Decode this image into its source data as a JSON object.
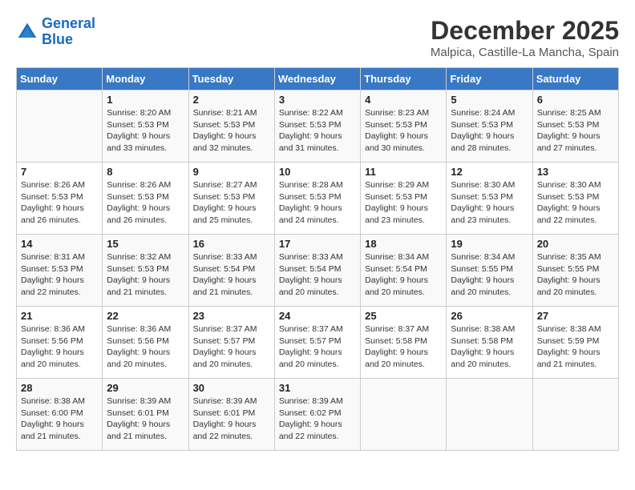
{
  "logo": {
    "line1": "General",
    "line2": "Blue"
  },
  "title": "December 2025",
  "location": "Malpica, Castille-La Mancha, Spain",
  "headers": [
    "Sunday",
    "Monday",
    "Tuesday",
    "Wednesday",
    "Thursday",
    "Friday",
    "Saturday"
  ],
  "weeks": [
    [
      {
        "day": "",
        "info": ""
      },
      {
        "day": "1",
        "info": "Sunrise: 8:20 AM\nSunset: 5:53 PM\nDaylight: 9 hours\nand 33 minutes."
      },
      {
        "day": "2",
        "info": "Sunrise: 8:21 AM\nSunset: 5:53 PM\nDaylight: 9 hours\nand 32 minutes."
      },
      {
        "day": "3",
        "info": "Sunrise: 8:22 AM\nSunset: 5:53 PM\nDaylight: 9 hours\nand 31 minutes."
      },
      {
        "day": "4",
        "info": "Sunrise: 8:23 AM\nSunset: 5:53 PM\nDaylight: 9 hours\nand 30 minutes."
      },
      {
        "day": "5",
        "info": "Sunrise: 8:24 AM\nSunset: 5:53 PM\nDaylight: 9 hours\nand 28 minutes."
      },
      {
        "day": "6",
        "info": "Sunrise: 8:25 AM\nSunset: 5:53 PM\nDaylight: 9 hours\nand 27 minutes."
      }
    ],
    [
      {
        "day": "7",
        "info": "Sunrise: 8:26 AM\nSunset: 5:53 PM\nDaylight: 9 hours\nand 26 minutes."
      },
      {
        "day": "8",
        "info": "Sunrise: 8:26 AM\nSunset: 5:53 PM\nDaylight: 9 hours\nand 26 minutes."
      },
      {
        "day": "9",
        "info": "Sunrise: 8:27 AM\nSunset: 5:53 PM\nDaylight: 9 hours\nand 25 minutes."
      },
      {
        "day": "10",
        "info": "Sunrise: 8:28 AM\nSunset: 5:53 PM\nDaylight: 9 hours\nand 24 minutes."
      },
      {
        "day": "11",
        "info": "Sunrise: 8:29 AM\nSunset: 5:53 PM\nDaylight: 9 hours\nand 23 minutes."
      },
      {
        "day": "12",
        "info": "Sunrise: 8:30 AM\nSunset: 5:53 PM\nDaylight: 9 hours\nand 23 minutes."
      },
      {
        "day": "13",
        "info": "Sunrise: 8:30 AM\nSunset: 5:53 PM\nDaylight: 9 hours\nand 22 minutes."
      }
    ],
    [
      {
        "day": "14",
        "info": "Sunrise: 8:31 AM\nSunset: 5:53 PM\nDaylight: 9 hours\nand 22 minutes."
      },
      {
        "day": "15",
        "info": "Sunrise: 8:32 AM\nSunset: 5:53 PM\nDaylight: 9 hours\nand 21 minutes."
      },
      {
        "day": "16",
        "info": "Sunrise: 8:33 AM\nSunset: 5:54 PM\nDaylight: 9 hours\nand 21 minutes."
      },
      {
        "day": "17",
        "info": "Sunrise: 8:33 AM\nSunset: 5:54 PM\nDaylight: 9 hours\nand 20 minutes."
      },
      {
        "day": "18",
        "info": "Sunrise: 8:34 AM\nSunset: 5:54 PM\nDaylight: 9 hours\nand 20 minutes."
      },
      {
        "day": "19",
        "info": "Sunrise: 8:34 AM\nSunset: 5:55 PM\nDaylight: 9 hours\nand 20 minutes."
      },
      {
        "day": "20",
        "info": "Sunrise: 8:35 AM\nSunset: 5:55 PM\nDaylight: 9 hours\nand 20 minutes."
      }
    ],
    [
      {
        "day": "21",
        "info": "Sunrise: 8:36 AM\nSunset: 5:56 PM\nDaylight: 9 hours\nand 20 minutes."
      },
      {
        "day": "22",
        "info": "Sunrise: 8:36 AM\nSunset: 5:56 PM\nDaylight: 9 hours\nand 20 minutes."
      },
      {
        "day": "23",
        "info": "Sunrise: 8:37 AM\nSunset: 5:57 PM\nDaylight: 9 hours\nand 20 minutes."
      },
      {
        "day": "24",
        "info": "Sunrise: 8:37 AM\nSunset: 5:57 PM\nDaylight: 9 hours\nand 20 minutes."
      },
      {
        "day": "25",
        "info": "Sunrise: 8:37 AM\nSunset: 5:58 PM\nDaylight: 9 hours\nand 20 minutes."
      },
      {
        "day": "26",
        "info": "Sunrise: 8:38 AM\nSunset: 5:58 PM\nDaylight: 9 hours\nand 20 minutes."
      },
      {
        "day": "27",
        "info": "Sunrise: 8:38 AM\nSunset: 5:59 PM\nDaylight: 9 hours\nand 21 minutes."
      }
    ],
    [
      {
        "day": "28",
        "info": "Sunrise: 8:38 AM\nSunset: 6:00 PM\nDaylight: 9 hours\nand 21 minutes."
      },
      {
        "day": "29",
        "info": "Sunrise: 8:39 AM\nSunset: 6:01 PM\nDaylight: 9 hours\nand 21 minutes."
      },
      {
        "day": "30",
        "info": "Sunrise: 8:39 AM\nSunset: 6:01 PM\nDaylight: 9 hours\nand 22 minutes."
      },
      {
        "day": "31",
        "info": "Sunrise: 8:39 AM\nSunset: 6:02 PM\nDaylight: 9 hours\nand 22 minutes."
      },
      {
        "day": "",
        "info": ""
      },
      {
        "day": "",
        "info": ""
      },
      {
        "day": "",
        "info": ""
      }
    ]
  ]
}
